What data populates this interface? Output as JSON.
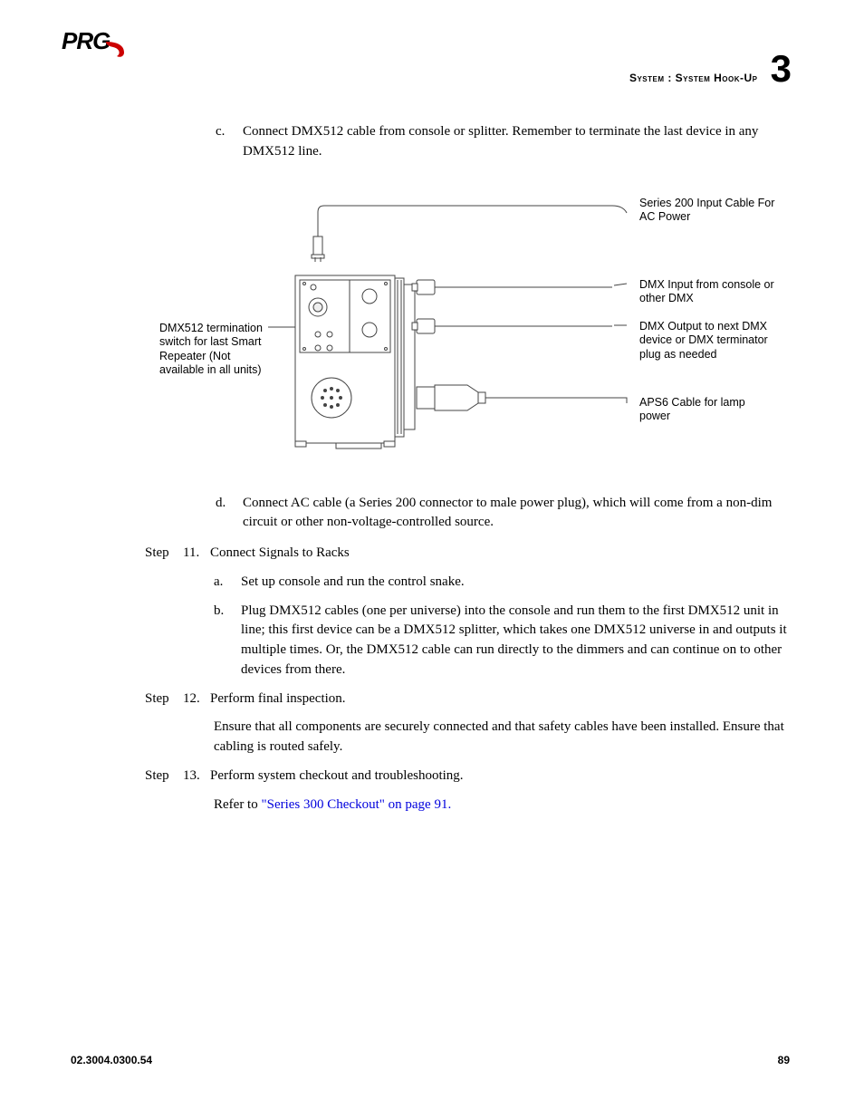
{
  "header": {
    "section": "System : System Hook-Up",
    "chapter_number": "3"
  },
  "logo": {
    "text": "PRG"
  },
  "items": {
    "c_marker": "c.",
    "c_text": "Connect DMX512 cable from console or splitter. Remember to terminate the last device in any DMX512 line.",
    "d_marker": "d.",
    "d_text": "Connect AC cable (a Series 200 connector to male power plug), which will come from a non-dim circuit or other non-voltage-controlled source."
  },
  "steps": [
    {
      "label": "Step",
      "num": "11.",
      "title": "Connect Signals to Racks",
      "subs": [
        {
          "marker": "a.",
          "text": "Set up console and run the control snake."
        },
        {
          "marker": "b.",
          "text": "Plug DMX512 cables (one per universe) into the console and run them to the first DMX512 unit in line; this first device can be a DMX512 splitter, which takes one DMX512 universe in and outputs it multiple times. Or, the DMX512 cable can run directly to the dimmers and can continue on to other devices from there."
        }
      ]
    },
    {
      "label": "Step",
      "num": "12.",
      "title": "Perform final inspection.",
      "body": "Ensure that all components are securely connected and that safety cables have been installed. Ensure that cabling is routed safely."
    },
    {
      "label": "Step",
      "num": "13.",
      "title": "Perform system checkout and troubleshooting.",
      "body_prefix": "Refer to ",
      "body_link": "\"Series 300 Checkout\" on page 91."
    }
  ],
  "diagram": {
    "left_label": "DMX512 termination switch for last Smart Repeater (Not available in all units)",
    "top_right_title": "Series 200 Input Cable For",
    "top_right_sub": "AC Power",
    "r2": "DMX Input from console or other DMX",
    "r3": "DMX Output to next DMX device or DMX terminator plug as needed",
    "r4": "APS6 Cable for lamp power"
  },
  "footer": {
    "doc_number": "02.3004.0300.54",
    "page": "89"
  }
}
